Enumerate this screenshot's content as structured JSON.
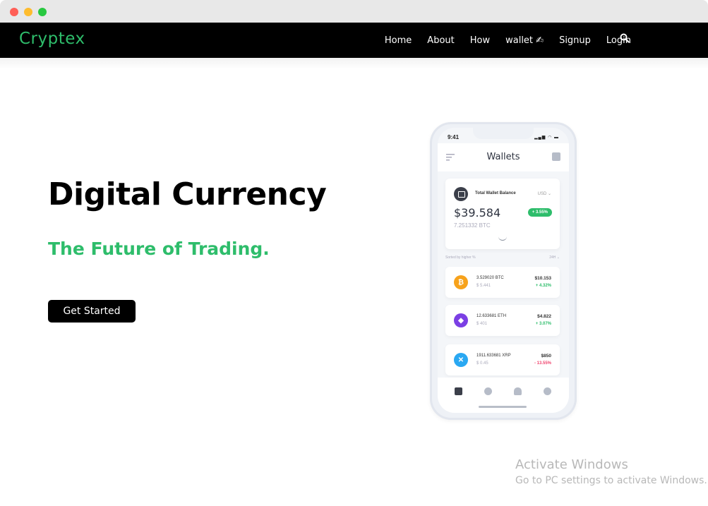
{
  "window": {
    "controls": [
      "close",
      "minimize",
      "maximize"
    ]
  },
  "navbar": {
    "brand": "Cryptex",
    "links": [
      {
        "label": "Home"
      },
      {
        "label": "About"
      },
      {
        "label": "How"
      },
      {
        "label": "wallet ✍"
      },
      {
        "label": "Signup"
      },
      {
        "label": "Login"
      }
    ],
    "search_icon": "search-icon"
  },
  "hero": {
    "title": "Digital Currency",
    "subtitle": "The Future of Trading.",
    "cta_label": "Get Started"
  },
  "phone": {
    "status_time": "9:41",
    "app_title": "Wallets",
    "balance": {
      "label": "Total Wallet Balance",
      "currency": "USD ⌄",
      "amount": "$39.584",
      "btc": "7.251332 BTC",
      "change": "+ 3.55%"
    },
    "sort_label": "Sorted by higher %",
    "sort_period": "24H ⌄",
    "coins": [
      {
        "symbol_glyph": "₿",
        "amount": "3.529020 BTC",
        "price": "$ 5.441",
        "value": "$10.153",
        "change": "+ 4.32%",
        "change_color": "#2ebd6b",
        "color": "#f7a21b"
      },
      {
        "symbol_glyph": "◆",
        "amount": "12.633681 ETH",
        "price": "$ 401",
        "value": "$4.822",
        "change": "+ 3.07%",
        "change_color": "#2ebd6b",
        "color": "#7b3fe4"
      },
      {
        "symbol_glyph": "✕",
        "amount": "1911.633681 XRP",
        "price": "$ 0.45",
        "value": "$850",
        "change": "- 13.55%",
        "change_color": "#f0446e",
        "color": "#2aa8f2"
      }
    ],
    "tabs": [
      "wallet-icon",
      "compass-icon",
      "bell-icon",
      "gear-icon"
    ]
  },
  "watermark": {
    "line1": "Activate Windows",
    "line2": "Go to PC settings to activate Windows."
  },
  "colors": {
    "accent": "#2ebd6b",
    "navbar_bg": "#000000"
  }
}
